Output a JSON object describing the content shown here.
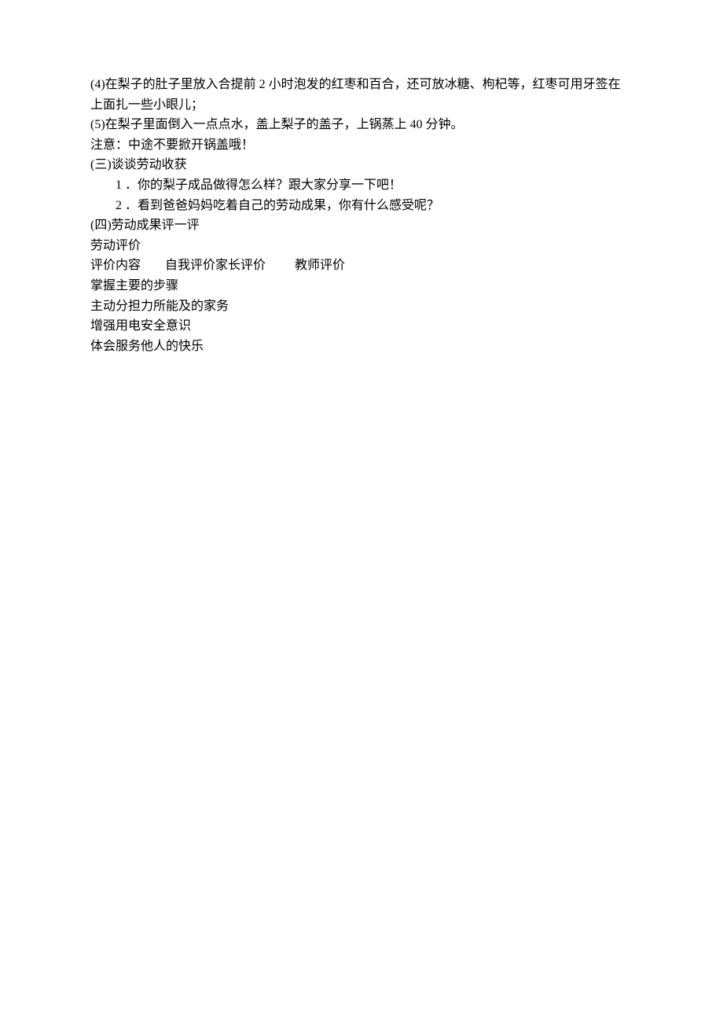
{
  "lines": {
    "p1": "(4)在梨子的肚子里放入合提前 2 小时泡发的红枣和百合，还可放冰糖、枸杞等，红枣可用牙签在上面扎一些小眼儿；",
    "p2": "(5)在梨子里面倒入一点点水，盖上梨子的盖子，上锅蒸上 40 分钟。",
    "p3": "注意：中途不要掀开锅盖哦！",
    "p4": "(三)谈谈劳动收获",
    "p5": "1 ．你的梨子成品做得怎么样？跟大家分享一下吧！",
    "p6": "2 ．看到爸爸妈妈吃着自己的劳动成果，你有什么感受呢？",
    "p7": "(四)劳动成果评一评",
    "p8": "劳动评价"
  },
  "eval": {
    "header": {
      "c1": "评价内容",
      "c2": "自我评价家长评价",
      "c3": "教师评价"
    },
    "rows": [
      "掌握主要的步骤",
      "主动分担力所能及的家务",
      "增强用电安全意识",
      "体会服务他人的快乐"
    ]
  }
}
